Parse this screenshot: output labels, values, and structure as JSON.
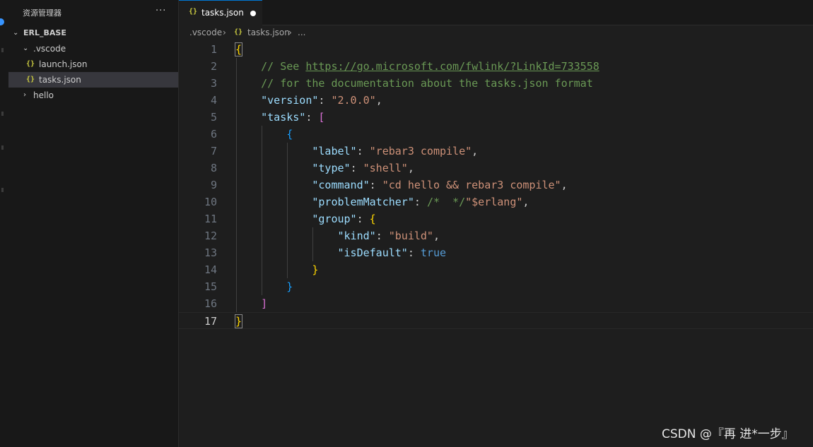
{
  "explorer": {
    "title": "资源管理器",
    "more": "···",
    "workspace": "ERL_BASE",
    "items": [
      {
        "label": ".vscode"
      },
      {
        "label": "launch.json"
      },
      {
        "label": "tasks.json"
      },
      {
        "label": "hello"
      }
    ]
  },
  "tab": {
    "label": "tasks.json",
    "icon": "{}"
  },
  "breadcrumb": {
    "folder": ".vscode",
    "file": "tasks.json",
    "more": "..."
  },
  "editor": {
    "line_numbers": [
      "1",
      "2",
      "3",
      "4",
      "5",
      "6",
      "7",
      "8",
      "9",
      "10",
      "11",
      "12",
      "13",
      "14",
      "15",
      "16",
      "17"
    ],
    "current_line": 17,
    "lines": [
      [
        {
          "t": "{",
          "c": "t-b1"
        }
      ],
      [
        {
          "t": "    // See ",
          "c": "t-c"
        },
        {
          "t": "https://go.microsoft.com/fwlink/?LinkId=733558",
          "c": "t-u"
        }
      ],
      [
        {
          "t": "    // for the documentation about the tasks.json format",
          "c": "t-c"
        }
      ],
      [
        {
          "t": "    ",
          "c": "t-p"
        },
        {
          "t": "\"version\"",
          "c": "t-k"
        },
        {
          "t": ": ",
          "c": "t-p"
        },
        {
          "t": "\"2.0.0\"",
          "c": "t-s"
        },
        {
          "t": ",",
          "c": "t-p"
        }
      ],
      [
        {
          "t": "    ",
          "c": "t-p"
        },
        {
          "t": "\"tasks\"",
          "c": "t-k"
        },
        {
          "t": ": ",
          "c": "t-p"
        },
        {
          "t": "[",
          "c": "t-b2"
        }
      ],
      [
        {
          "t": "        ",
          "c": "t-p"
        },
        {
          "t": "{",
          "c": "t-b3"
        }
      ],
      [
        {
          "t": "            ",
          "c": "t-p"
        },
        {
          "t": "\"label\"",
          "c": "t-k"
        },
        {
          "t": ": ",
          "c": "t-p"
        },
        {
          "t": "\"rebar3 compile\"",
          "c": "t-s"
        },
        {
          "t": ",",
          "c": "t-p"
        }
      ],
      [
        {
          "t": "            ",
          "c": "t-p"
        },
        {
          "t": "\"type\"",
          "c": "t-k"
        },
        {
          "t": ": ",
          "c": "t-p"
        },
        {
          "t": "\"shell\"",
          "c": "t-s"
        },
        {
          "t": ",",
          "c": "t-p"
        }
      ],
      [
        {
          "t": "            ",
          "c": "t-p"
        },
        {
          "t": "\"command\"",
          "c": "t-k"
        },
        {
          "t": ": ",
          "c": "t-p"
        },
        {
          "t": "\"cd hello && rebar3 compile\"",
          "c": "t-s"
        },
        {
          "t": ",",
          "c": "t-p"
        }
      ],
      [
        {
          "t": "            ",
          "c": "t-p"
        },
        {
          "t": "\"problemMatcher\"",
          "c": "t-k"
        },
        {
          "t": ": ",
          "c": "t-p"
        },
        {
          "t": "/*  */",
          "c": "t-c"
        },
        {
          "t": "\"$erlang\"",
          "c": "t-s"
        },
        {
          "t": ",",
          "c": "t-p"
        }
      ],
      [
        {
          "t": "            ",
          "c": "t-p"
        },
        {
          "t": "\"group\"",
          "c": "t-k"
        },
        {
          "t": ": ",
          "c": "t-p"
        },
        {
          "t": "{",
          "c": "t-b1"
        }
      ],
      [
        {
          "t": "                ",
          "c": "t-p"
        },
        {
          "t": "\"kind\"",
          "c": "t-k"
        },
        {
          "t": ": ",
          "c": "t-p"
        },
        {
          "t": "\"build\"",
          "c": "t-s"
        },
        {
          "t": ",",
          "c": "t-p"
        }
      ],
      [
        {
          "t": "                ",
          "c": "t-p"
        },
        {
          "t": "\"isDefault\"",
          "c": "t-k"
        },
        {
          "t": ": ",
          "c": "t-p"
        },
        {
          "t": "true",
          "c": "t-kw"
        }
      ],
      [
        {
          "t": "            ",
          "c": "t-p"
        },
        {
          "t": "}",
          "c": "t-b1"
        }
      ],
      [
        {
          "t": "        ",
          "c": "t-p"
        },
        {
          "t": "}",
          "c": "t-b3"
        }
      ],
      [
        {
          "t": "    ",
          "c": "t-p"
        },
        {
          "t": "]",
          "c": "t-b2"
        }
      ],
      [
        {
          "t": "}",
          "c": "t-b1"
        }
      ]
    ]
  },
  "watermark": "CSDN @『再 进*一步』",
  "colors": {
    "accent": "#0078d4",
    "json_icon": "#cbcb41",
    "comment": "#6a9955",
    "key": "#9cdcfe",
    "string": "#ce9178"
  }
}
